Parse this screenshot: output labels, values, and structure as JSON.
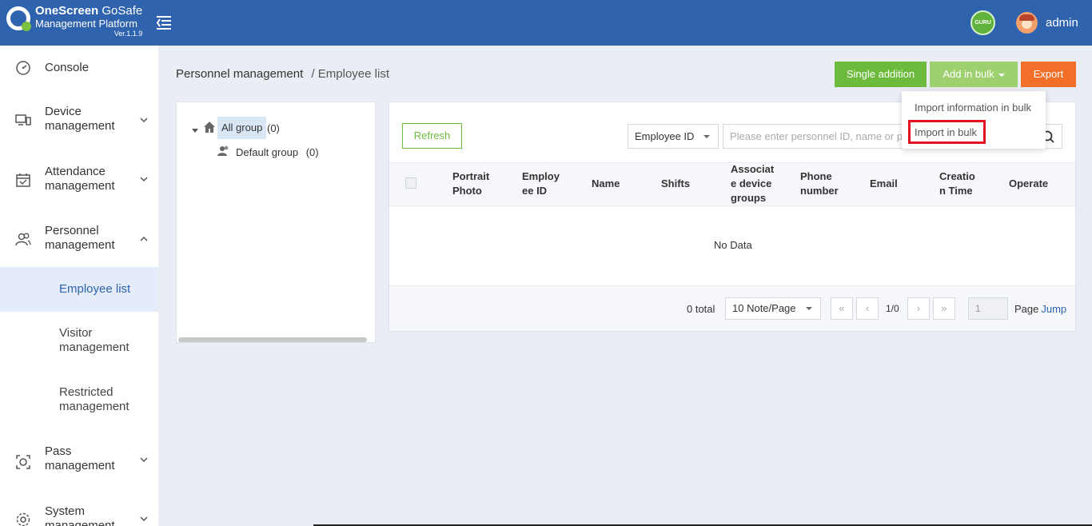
{
  "header": {
    "brand_name": "OneScreen",
    "brand_product": " GoSafe",
    "brand_sub": "Management Platform",
    "version": "Ver.1.1.9",
    "guru_badge": "GURU",
    "username": "admin"
  },
  "sidebar": {
    "items": [
      {
        "label": "Console",
        "icon": "dashboard-icon"
      },
      {
        "label": "Device management",
        "icon": "monitor-icon",
        "expanded": false
      },
      {
        "label": "Attendance management",
        "icon": "calendar-check-icon",
        "expanded": false
      },
      {
        "label": "Personnel management",
        "icon": "users-icon",
        "expanded": true
      },
      {
        "label": "Pass management",
        "icon": "face-scan-icon",
        "expanded": false
      },
      {
        "label": "System management",
        "icon": "gear-icon",
        "expanded": false
      }
    ],
    "sub_items": [
      {
        "label": "Employee list",
        "active": true
      },
      {
        "label": "Visitor management",
        "active": false
      },
      {
        "label": "Restricted management",
        "active": false
      }
    ]
  },
  "breadcrumb": {
    "level1": "Personnel management",
    "separator": "/",
    "level2": "Employee list"
  },
  "toolbar": {
    "single_addition": "Single addition",
    "add_in_bulk": "Add in bulk",
    "export": "Export"
  },
  "dropdown": {
    "items": [
      "Import information in bulk",
      "Import in bulk"
    ],
    "highlighted": "Import in bulk"
  },
  "tree": {
    "root_label": "All group",
    "root_count": "(0)",
    "child_label": "Default group",
    "child_count": "(0)"
  },
  "filters": {
    "refresh": "Refresh",
    "select_value": "Employee ID",
    "search_placeholder": "Please enter personnel ID, name or phone"
  },
  "table": {
    "columns": [
      "Portrait Photo",
      "Employ ee ID",
      "Name",
      "Shifts",
      "Associat e device groups",
      "Phone number",
      "Email",
      "Creatio n Time",
      "Operate"
    ],
    "empty_text": "No Data"
  },
  "pagination": {
    "total": "0 total",
    "page_size": "10 Note/Page",
    "first": "«",
    "prev": "‹",
    "current": "1/0",
    "next": "›",
    "last": "»",
    "jump_value": "1",
    "page_label": "Page",
    "jump_label": "Jump"
  },
  "colors": {
    "header_bg": "#2f63ae",
    "primary_green": "#6dbb3c",
    "light_green": "#9ed06f",
    "export_orange": "#f26f2a",
    "highlight_red": "#e0121f",
    "active_bg": "#e3ecf8"
  }
}
